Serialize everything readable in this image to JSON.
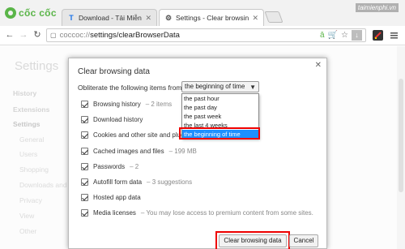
{
  "browser": {
    "logo_text": "cốc cốc",
    "watermark": "taimienphi.vn",
    "tabs": [
      {
        "title": "Download - Tải Miễn Phí",
        "icon": "T"
      },
      {
        "title": "Settings - Clear browsing",
        "icon": "⚙"
      }
    ],
    "url_host": "coccoc://",
    "url_path": "settings/clearBrowserData"
  },
  "settings": {
    "title": "Settings",
    "sidebar": [
      "History",
      "Extensions",
      "Settings",
      "General",
      "Users",
      "Shopping",
      "Downloads and settings",
      "Privacy",
      "View",
      "Other"
    ]
  },
  "dialog": {
    "title": "Clear browsing data",
    "obliterate_label": "Obliterate the following items from:",
    "selected_range": "the beginning of time",
    "range_options": [
      "the past hour",
      "the past day",
      "the past week",
      "the last 4 weeks",
      "the beginning of time"
    ],
    "items": [
      {
        "label": "Browsing history",
        "extra": "– 2 items"
      },
      {
        "label": "Download history",
        "extra": ""
      },
      {
        "label": "Cookies and other site and plugin data",
        "extra": ""
      },
      {
        "label": "Cached images and files",
        "extra": "– 199 MB"
      },
      {
        "label": "Passwords",
        "extra": "– 2"
      },
      {
        "label": "Autofill form data",
        "extra": "– 3 suggestions"
      },
      {
        "label": "Hosted app data",
        "extra": ""
      },
      {
        "label": "Media licenses",
        "extra": "– You may lose access to premium content from some sites."
      }
    ],
    "clear_button": "Clear browsing data",
    "cancel_button": "Cancel"
  }
}
